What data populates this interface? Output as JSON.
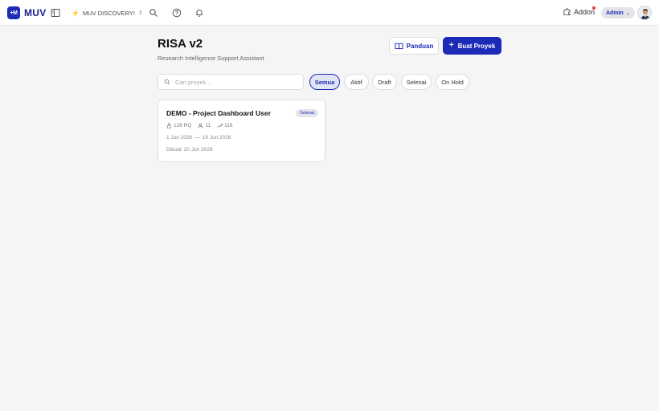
{
  "topbar": {
    "logo_badge": "+M",
    "logo_text": "MUV",
    "workspace": "MUV DISCOVERY!",
    "addon_label": "Addon",
    "role_label": "Admin",
    "icons": [
      "sidebar-toggle-icon",
      "search-icon",
      "help-icon",
      "bell-icon",
      "puzzle-icon"
    ]
  },
  "header": {
    "title": "RISA v2",
    "subtitle": "Research Intelligence Support Assistant",
    "guide_label": "Panduan",
    "create_label": "Buat Proyek"
  },
  "search": {
    "placeholder": "Cari proyek..."
  },
  "filters": [
    {
      "label": "Semua",
      "active": true
    },
    {
      "label": "Aktif",
      "active": false
    },
    {
      "label": "Draft",
      "active": false
    },
    {
      "label": "Selesai",
      "active": false
    },
    {
      "label": "On Hold",
      "active": false
    }
  ],
  "projects": [
    {
      "title": "DEMO - Project Dashboard User",
      "status": "Selesai",
      "rq": "128 RQ",
      "users": "11",
      "trend": "116",
      "start_date": "1 Jun 2026",
      "date_sep": "—",
      "end_date": "19 Jun 2026",
      "created_label": "Dibuat",
      "created_date": "20 Jun 2026"
    }
  ],
  "colors": {
    "brand": "#1b2bb8",
    "notification": "#e53935",
    "bolt": "#f0b429"
  }
}
